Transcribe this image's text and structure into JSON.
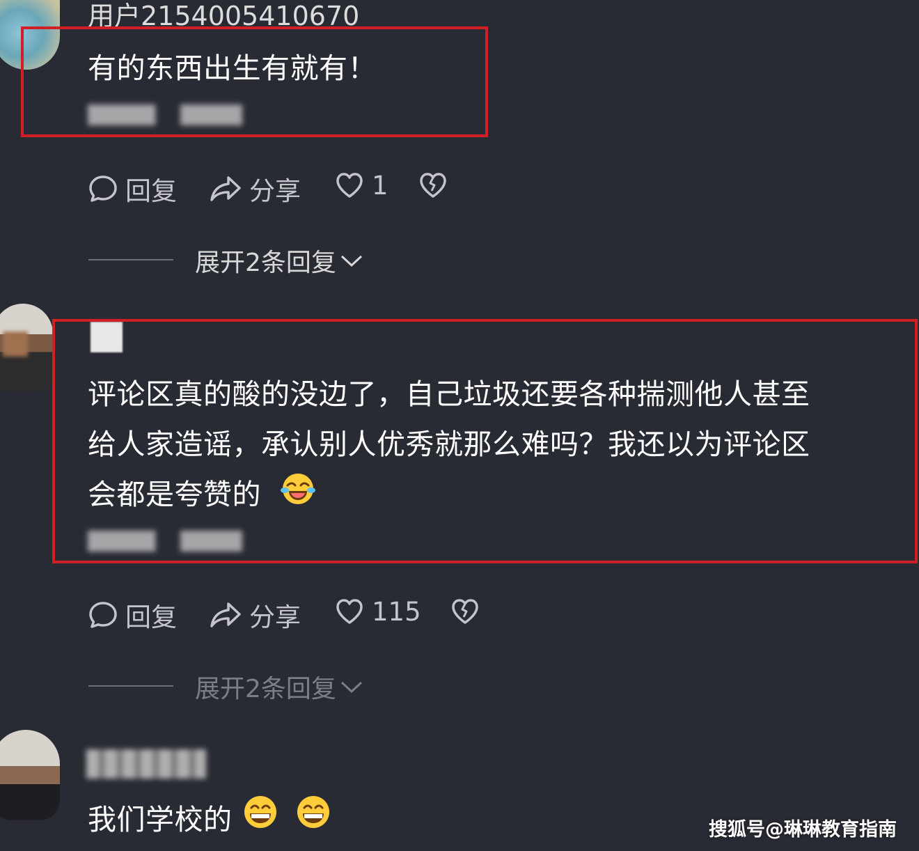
{
  "comments": [
    {
      "username": "用户2154005410670",
      "text": "有的东西出生有就有！",
      "reply_label": "回复",
      "share_label": "分享",
      "like_count": "1",
      "expand_label": "展开2条回复"
    },
    {
      "text_line1": "评论区真的酸的没边了，自己垃圾还要各种揣测他人甚至",
      "text_line2": "给人家造谣，承认别人优秀就那么难吗？我还以为评论区",
      "text_line3": "会都是夸赞的",
      "reply_label": "回复",
      "share_label": "分享",
      "like_count": "115",
      "expand_label": "展开2条回复"
    },
    {
      "text": "我们学校的"
    }
  ],
  "watermark": "搜狐号@琳琳教育指南",
  "colors": {
    "background": "#292b34",
    "highlight_box": "#d21e25",
    "action_text": "#c4c5cb"
  },
  "icons": [
    "comment-bubble-icon",
    "share-arrow-icon",
    "heart-icon",
    "broken-heart-icon",
    "chevron-down-icon",
    "laugh-cry-emoji",
    "grin-emoji"
  ]
}
